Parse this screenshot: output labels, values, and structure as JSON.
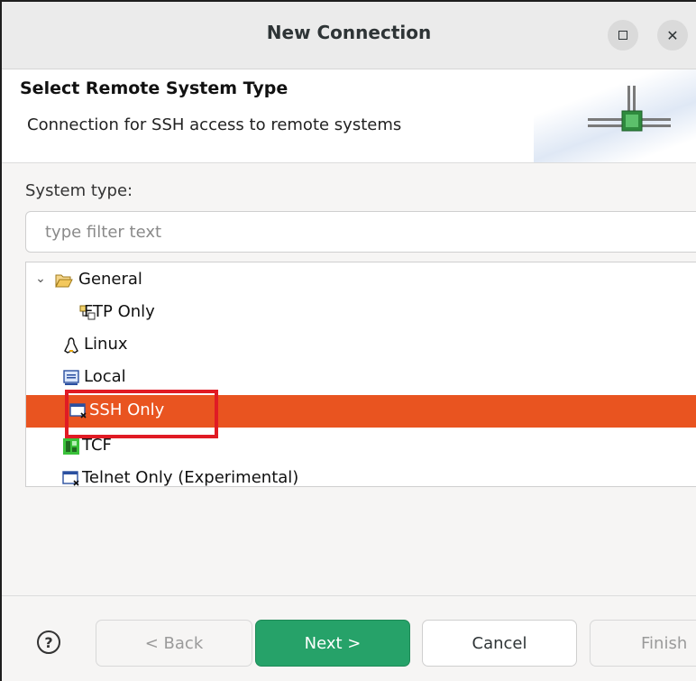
{
  "window": {
    "title": "New Connection"
  },
  "banner": {
    "title": "Select Remote System Type",
    "description": "Connection for SSH access to remote systems",
    "icon": "connection-network-icon"
  },
  "system_type": {
    "label": "System type:",
    "filter_placeholder": "type filter text",
    "tree": {
      "group": {
        "label": "General",
        "expanded": true,
        "icon": "folder-open-icon"
      },
      "items": [
        {
          "label": "FTP Only",
          "icon": "ftp-icon"
        },
        {
          "label": "Linux",
          "icon": "linux-icon"
        },
        {
          "label": "Local",
          "icon": "local-icon"
        },
        {
          "label": "SSH Only",
          "icon": "ssh-icon",
          "selected": true
        },
        {
          "label": "TCF",
          "icon": "tcf-icon"
        },
        {
          "label": "Telnet Only (Experimental)",
          "icon": "telnet-icon"
        }
      ]
    }
  },
  "buttons": {
    "help": "?",
    "back": "< Back",
    "next": "Next >",
    "cancel": "Cancel",
    "finish": "Finish"
  },
  "colors": {
    "selection": "#e95420",
    "primary_button": "#26a269",
    "highlight_box": "#e01b24"
  }
}
